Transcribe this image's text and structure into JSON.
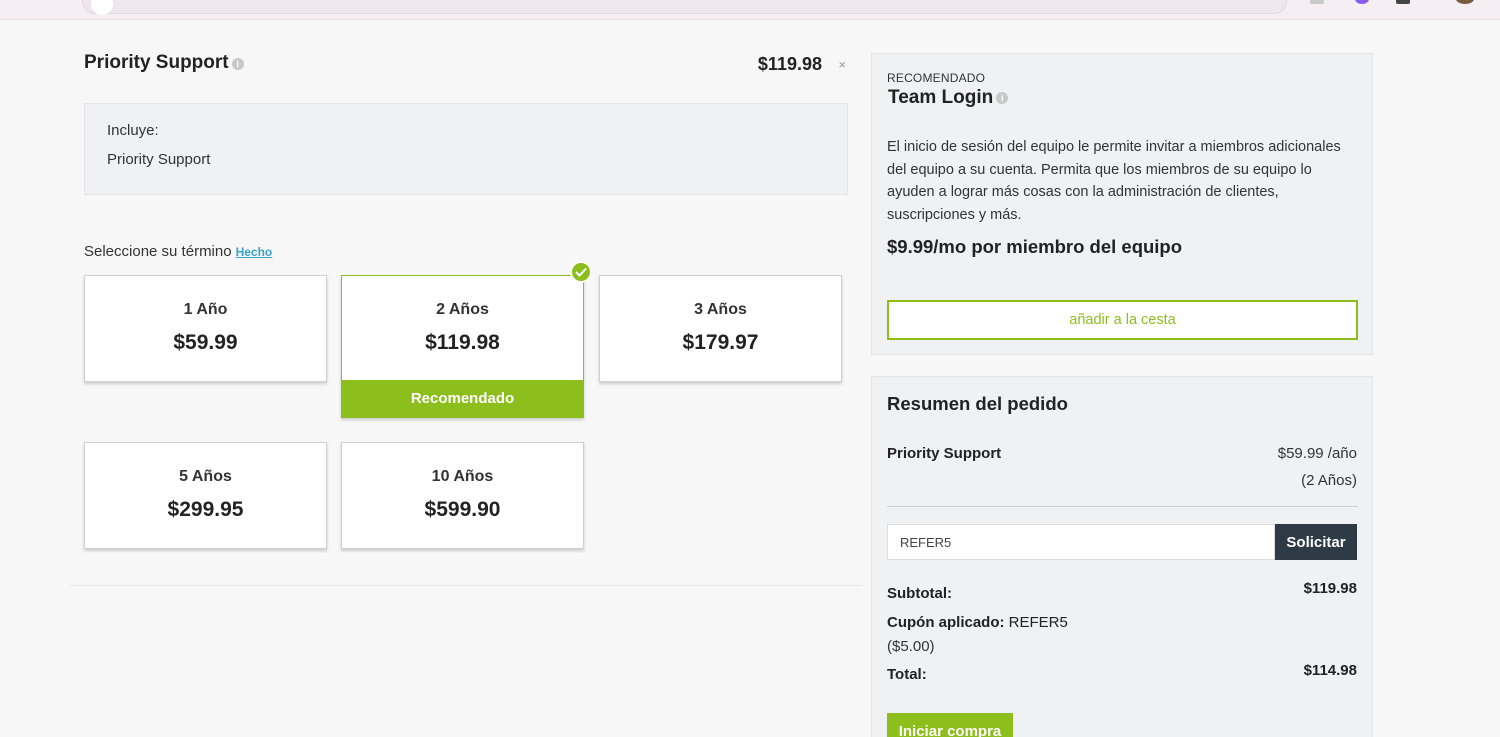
{
  "product": {
    "title": "Priority Support",
    "price": "$119.98",
    "remove_symbol": "×",
    "includes_label": "Incluye:",
    "includes_items": [
      "Priority Support"
    ]
  },
  "term_selector": {
    "label": "Seleccione su término",
    "done_link": "Hecho",
    "plans": [
      {
        "term": "1 Año",
        "price": "$59.99",
        "selected": false
      },
      {
        "term": "2 Años",
        "price": "$119.98",
        "selected": true
      },
      {
        "term": "3 Años",
        "price": "$179.97",
        "selected": false
      },
      {
        "term": "5 Años",
        "price": "$299.95",
        "selected": false
      },
      {
        "term": "10 Años",
        "price": "$599.90",
        "selected": false
      }
    ],
    "recommended_badge": "Recomendado"
  },
  "upsell": {
    "tag": "RECOMENDADO",
    "name": "Team Login",
    "description": "El inicio de sesión del equipo le permite invitar a miembros adicionales del equipo a su cuenta. Permita que los miembros de su equipo lo ayuden a lograr más cosas con la administración de clientes, suscripciones y más.",
    "rate": "$9.99/mo por miembro del equipo",
    "add_button": "añadir a la cesta"
  },
  "summary": {
    "heading": "Resumen del pedido",
    "item_name": "Priority Support",
    "item_price": "$59.99 /año",
    "item_term": "(2 Años)",
    "coupon_value": "REFER5",
    "apply_button": "Solicitar",
    "subtotal_label": "Subtotal:",
    "subtotal_value": "$119.98",
    "coupon_label": "Cupón aplicado:",
    "coupon_code": "REFER5",
    "discount": "($5.00)",
    "total_label": "Total:",
    "total_value": "$114.98",
    "checkout_button": "Iniciar compra"
  },
  "colors": {
    "accent_green": "#8dbf1c",
    "dark_button": "#2f3a47",
    "link_blue": "#3aa3c9"
  }
}
